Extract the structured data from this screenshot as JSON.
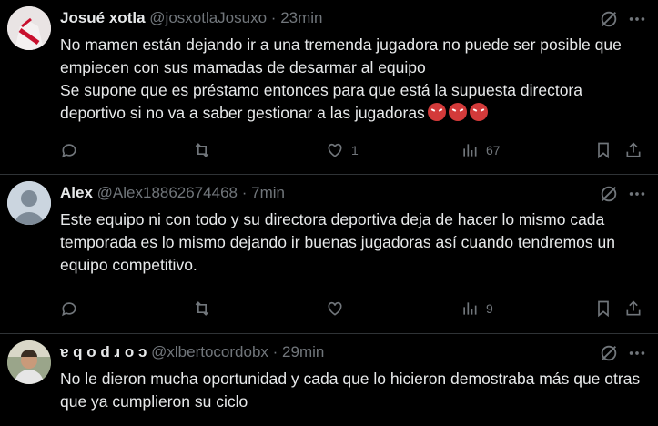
{
  "tweets": [
    {
      "name": "Josué xotla",
      "handle": "@josxotlaJosuxo",
      "dot": "·",
      "time": "23min",
      "text": "No mamen están dejando ir a una tremenda jugadora no puede ser posible que empiecen con sus mamadas de desarmar al equipo\nSe supone que es préstamo entonces para que está la supuesta directora deportivo si no va a saber gestionar a las jugadoras",
      "emoji": "😡😡😡",
      "likes": "1",
      "views": "67"
    },
    {
      "name": "Alex",
      "handle": "@Alex18862674468",
      "dot": "·",
      "time": "7min",
      "text": "Este equipo ni con todo y su  directora deportiva deja de hacer lo mismo cada temporada es lo mismo dejando ir buenas jugadoras así cuando tendremos un equipo competitivo.",
      "views": "9"
    },
    {
      "name": "ɐ q o d ɹ o ɔ",
      "handle": "@xlbertocordobx",
      "dot": "·",
      "time": "29min",
      "text": "No le dieron mucha oportunidad y cada que lo hicieron demostraba más que otras que ya cumplieron su ciclo"
    }
  ],
  "icons": {
    "reply": "reply-icon",
    "retweet": "retweet-icon",
    "like": "heart-icon",
    "views": "views-icon",
    "bookmark": "bookmark-icon",
    "share": "share-icon",
    "grok": "grok-icon",
    "avatar_default": "default-avatar"
  },
  "colors": {
    "background": "#000000",
    "text": "#e7e9ea",
    "muted": "#71767b",
    "divider": "#2f3336"
  }
}
